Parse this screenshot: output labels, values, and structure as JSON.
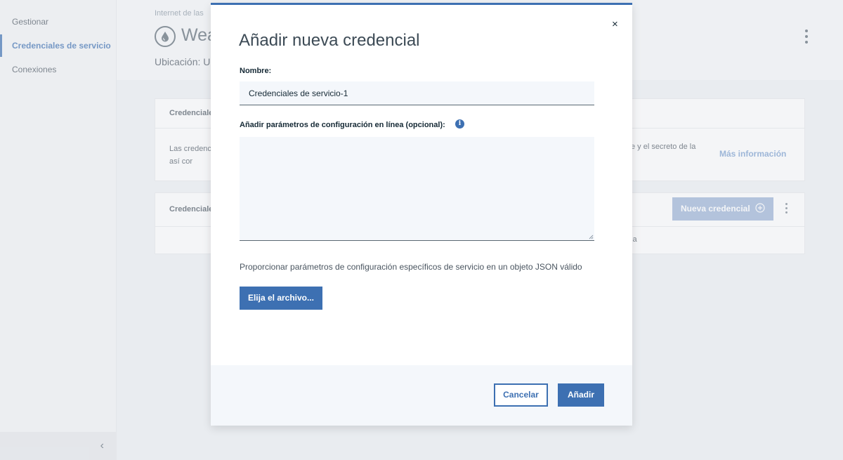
{
  "sidebar": {
    "items": [
      {
        "label": "Gestionar"
      },
      {
        "label": "Credenciales de servicio"
      },
      {
        "label": "Conexiones"
      }
    ],
    "collapse_glyph": "‹"
  },
  "header": {
    "breadcrumb": "Internet de las",
    "title": "Wea",
    "location": "Ubicación: Ur"
  },
  "cards": {
    "info_title": "Credenciale",
    "info_desc": "Las credenc API, así cor",
    "info_desc_right": "e y el secreto de la",
    "more_link": "Más información",
    "list_title": "Credenciale",
    "new_button": "Nueva credencial",
    "row_fragment": "ia"
  },
  "modal": {
    "title": "Añadir nueva credencial",
    "close_glyph": "×",
    "name_label": "Nombre:",
    "name_value": "Credenciales de servicio-1",
    "params_label": "Añadir parámetros de configuración en línea (opcional):",
    "info_glyph": "i",
    "help_text": "Proporcionar parámetros de configuración específicos de servicio en un objeto JSON válido",
    "file_button": "Elija el archivo...",
    "cancel_button": "Cancelar",
    "add_button": "Añadir"
  },
  "colors": {
    "accent": "#3d70b2",
    "accent_disabled": "#9bb3d6",
    "field_bg": "#f4f7fb"
  },
  "icons": [
    "water-drop-icon",
    "overflow-menu-icon",
    "add-circle-icon",
    "info-icon",
    "close-icon",
    "chevron-left-icon",
    "resize-handle-icon"
  ]
}
